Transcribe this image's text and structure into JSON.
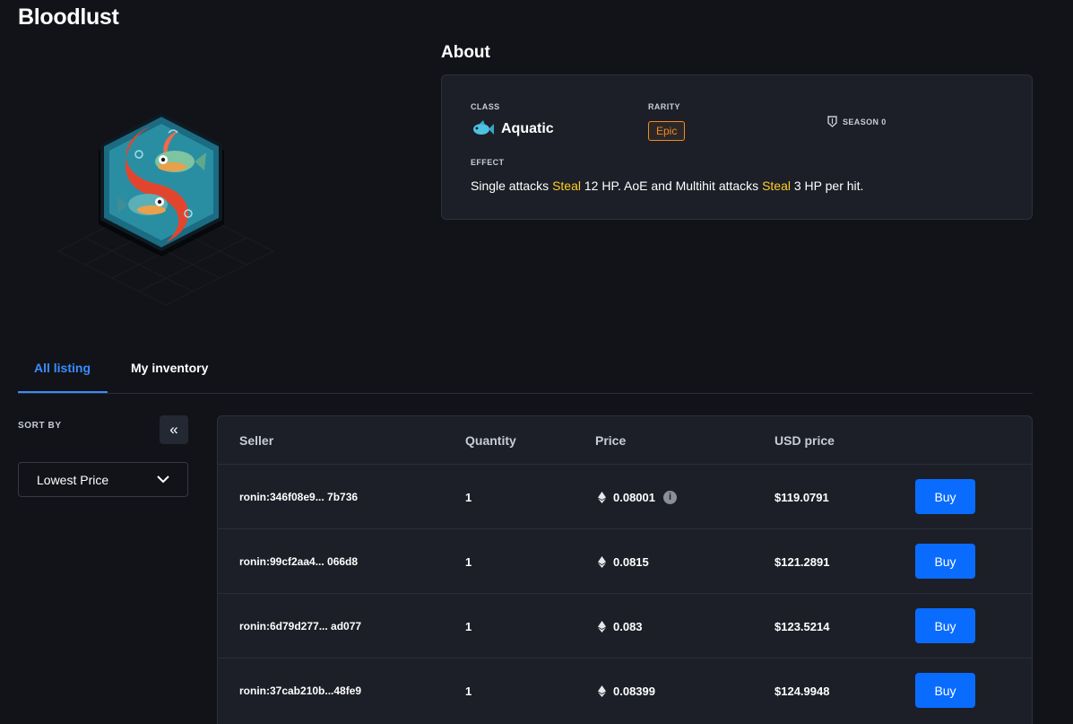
{
  "page": {
    "title": "Bloodlust"
  },
  "about": {
    "heading": "About",
    "class_label": "CLASS",
    "class_value": "Aquatic",
    "rarity_label": "RARITY",
    "rarity_value": "Epic",
    "season": "SEASON 0",
    "effect_label": "EFFECT",
    "effect": {
      "part1": "Single attacks ",
      "hl1": "Steal",
      "part2": " 12 HP. AoE and Multihit attacks ",
      "hl2": "Steal",
      "part3": " 3 HP per hit."
    }
  },
  "tabs": [
    {
      "label": "All listing",
      "active": true
    },
    {
      "label": "My inventory",
      "active": false
    }
  ],
  "sort": {
    "label": "SORT BY",
    "collapse_glyph": "«",
    "selected": "Lowest Price"
  },
  "table": {
    "headers": {
      "seller": "Seller",
      "quantity": "Quantity",
      "price": "Price",
      "usd": "USD price"
    },
    "rows": [
      {
        "seller": "ronin:346f08e9... 7b736",
        "quantity": "1",
        "price": "0.08001",
        "info": true,
        "usd": "$119.0791",
        "action": "Buy"
      },
      {
        "seller": "ronin:99cf2aa4... 066d8",
        "quantity": "1",
        "price": "0.0815",
        "info": false,
        "usd": "$121.2891",
        "action": "Buy"
      },
      {
        "seller": "ronin:6d79d277... ad077",
        "quantity": "1",
        "price": "0.083",
        "info": false,
        "usd": "$123.5214",
        "action": "Buy"
      },
      {
        "seller": "ronin:37cab210b...48fe9",
        "quantity": "1",
        "price": "0.08399",
        "info": false,
        "usd": "$124.9948",
        "action": "Buy"
      }
    ]
  },
  "colors": {
    "background": "#111318",
    "card": "#1c1f27",
    "accent": "#0a6cff",
    "tab_active": "#3b8cff",
    "rarity_epic": "#f08a24",
    "highlight": "#ffd024"
  }
}
